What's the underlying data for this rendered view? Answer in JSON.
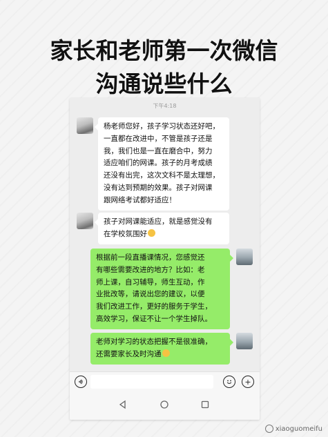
{
  "headline": {
    "line1": "家长和老师第一次微信",
    "line2": "沟通说些什么"
  },
  "chat": {
    "time": "下午4:18",
    "messages": [
      {
        "sender": "teacher",
        "lines": [
          "杨老师您好，孩子学习状态还好吧，",
          "一直都在改进中，不管是孩子还是",
          "我，我们也是一直在磨合中，努力",
          "适应咱们的网课。孩子的月考成绩",
          "还没有出完，这次文科不是太理想，",
          "没有达到预期的效果。孩子对网课",
          "跟网络考试都好适应！"
        ]
      },
      {
        "sender": "teacher",
        "lines": [
          "孩子对网课能适应，就是感觉没有",
          "在学校氛围好"
        ],
        "emoji": "sweat-smile-emoji"
      },
      {
        "sender": "parent",
        "lines": [
          "根据前一段直播课情况，您感觉还",
          "有哪些需要改进的地方？比如：老",
          "师上课，自习辅导，师生互动，作",
          "业批改等，请说出您的建议，以便",
          "我们改进工作，更好的服务于学生，",
          "高效学习，保证不让一个学生掉队。"
        ]
      },
      {
        "sender": "parent",
        "lines": [
          "老师对学习的状态把握不是很准确，",
          "还需要家长及时沟通"
        ],
        "emoji": "smile-emoji"
      }
    ]
  },
  "input_bar": {
    "voice_icon": "voice-icon",
    "emoji_icon": "emoji-icon",
    "plus_label": "+"
  },
  "nav": {
    "back": "back-icon",
    "home": "home-icon",
    "recent": "recent-apps-icon"
  },
  "watermark": {
    "text": "xiaoguomeifu"
  },
  "colors": {
    "green_bubble": "#95ec69",
    "white_bubble": "#ffffff",
    "chat_bg": "#ededed"
  }
}
